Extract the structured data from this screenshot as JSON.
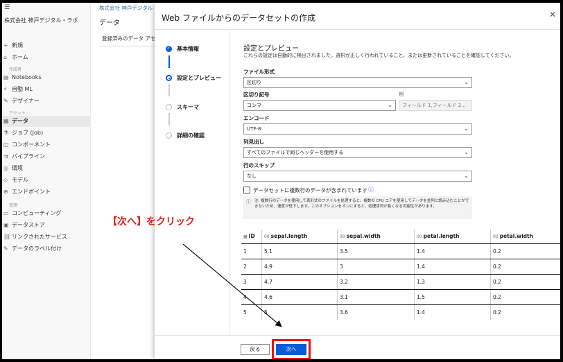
{
  "sidebar": {
    "top_icon": "☰",
    "org": "株式会社 神戸デジタル・ラボ",
    "items": [
      {
        "label": "新規",
        "icon": "plus-icon",
        "glyph": "+"
      },
      {
        "label": "ホーム",
        "icon": "home-icon",
        "glyph": "⌂"
      }
    ],
    "section_author": "作成者",
    "author_items": [
      {
        "label": "Notebooks",
        "glyph": "▤"
      },
      {
        "label": "自動 ML",
        "glyph": "⚡"
      },
      {
        "label": "デザイナー",
        "glyph": "✎"
      }
    ],
    "section_assets": "アセット",
    "asset_items": [
      {
        "label": "データ",
        "glyph": "▦",
        "active": true
      },
      {
        "label": "ジョブ (Job)",
        "glyph": "⚗"
      },
      {
        "label": "コンポーネント",
        "glyph": "◫"
      },
      {
        "label": "パイプライン",
        "glyph": "⇉"
      },
      {
        "label": "環境",
        "glyph": "◎"
      },
      {
        "label": "モデル",
        "glyph": "◇"
      },
      {
        "label": "エンドポイント",
        "glyph": "⊕"
      }
    ],
    "section_manage": "管理",
    "manage_items": [
      {
        "label": "コンピューティング",
        "glyph": "▭"
      },
      {
        "label": "データストア",
        "glyph": "▣"
      },
      {
        "label": "リンクされたサービス",
        "glyph": "⛓"
      },
      {
        "label": "データのラベル付け",
        "glyph": "✎"
      }
    ]
  },
  "middle": {
    "breadcrumb": "株式会社 神戸デジタル",
    "title": "データ",
    "tab": "登録済みのデータ アセ"
  },
  "dialog": {
    "title": "Web ファイルからのデータセットの作成",
    "close": "✕",
    "steps": [
      {
        "label": "基本情報",
        "state": "done"
      },
      {
        "label": "設定とプレビュー",
        "state": "current"
      },
      {
        "label": "スキーマ",
        "state": "todo"
      },
      {
        "label": "詳細の確認",
        "state": "todo"
      }
    ],
    "section_title": "設定とプレビュー",
    "section_desc": "これらの設定は自動的に検出されました。選択が正しく行われていること、または更新されていることを確認してください。",
    "file_format": {
      "label": "ファイル形式",
      "value": "区切り"
    },
    "delimiter": {
      "label": "区切り記号",
      "value": "コンマ",
      "example_label": "例",
      "example": "フィールド 1,フィールド 2..."
    },
    "encoding": {
      "label": "エンコード",
      "value": "UTF-8"
    },
    "headers": {
      "label": "列見出し",
      "value": "すべてのファイルで同じヘッダーを使用する"
    },
    "skip_rows": {
      "label": "行のスキップ",
      "value": "なし"
    },
    "multiline": {
      "label": "データセットに複数行のデータが含まれています",
      "checked": false
    },
    "note": "注: 複数行のデータを使用して表形式のファイルを処理すると、複数の CPU コアを使用してデータを並列に読み込むことができないため、速度が低下します。このオプションをオンにすると、処理序列が長くなる可能性があります。",
    "table": {
      "columns": [
        "ID",
        "sepal.length",
        "sepal.width",
        "petal.length",
        "petal.width"
      ],
      "rows": [
        [
          "1",
          "5.1",
          "3.5",
          "1.4",
          "0.2"
        ],
        [
          "2",
          "4.9",
          "3",
          "1.4",
          "0.2"
        ],
        [
          "3",
          "4.7",
          "3.2",
          "1.3",
          "0.2"
        ],
        [
          "4",
          "4.6",
          "3.1",
          "1.5",
          "0.2"
        ],
        [
          "5",
          "5",
          "3.6",
          "1.4",
          "0.2"
        ]
      ]
    },
    "back_label": "戻る",
    "next_label": "次へ"
  },
  "annotation": {
    "text": "【次へ】をクリック",
    "color": "#e0201a"
  },
  "colors": {
    "accent": "#0a5bd7",
    "highlight": "#ee1111"
  }
}
